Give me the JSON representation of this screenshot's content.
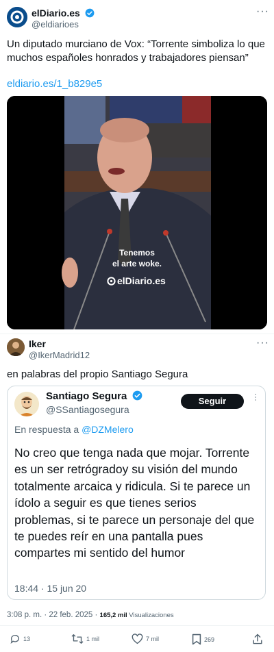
{
  "tweet1": {
    "name": "elDiario.es",
    "handle": "@eldiarioes",
    "text": "Un diputado murciano de Vox: “Torrente simboliza lo que muchos españoles honrados y trabajadores piensan”",
    "link": "eldiario.es/1_b829e5",
    "video_caption": [
      "Tenemos",
      "el arte woke."
    ],
    "video_brand": "elDiario.es"
  },
  "tweet2": {
    "name": "Iker",
    "handle": "@IkerMadrid12",
    "text": "en palabras del propio Santiago Segura",
    "quote": {
      "name": "Santiago Segura",
      "handle": "@SSantiagosegura",
      "follow_label": "Seguir",
      "reply_prefix": "En respuesta a ",
      "reply_to": "@DZMelero",
      "text": "No creo que tenga nada que mojar. Torrente es un ser retrógradoy su visión del mundo totalmente arcaica y ridicula. Si te parece un ídolo a seguir es que tienes serios problemas, si te parece un personaje del que te puedes reír en una pantalla pues compartes mi sentido del humor",
      "timestamp": "18:44 · 15 jun 20"
    },
    "meta": {
      "time": "3:08 p. m. · 22 feb. 2025 · ",
      "views": "165,2 mil",
      "views_label": " Visualizaciones"
    },
    "actions": {
      "replies": "13",
      "retweets": "1 mil",
      "likes": "7 mil",
      "bookmarks": "269"
    }
  },
  "colors": {
    "accent": "#1d9bf0",
    "text": "#0f1419",
    "muted": "#536471",
    "follow_bg": "#0f1419"
  }
}
